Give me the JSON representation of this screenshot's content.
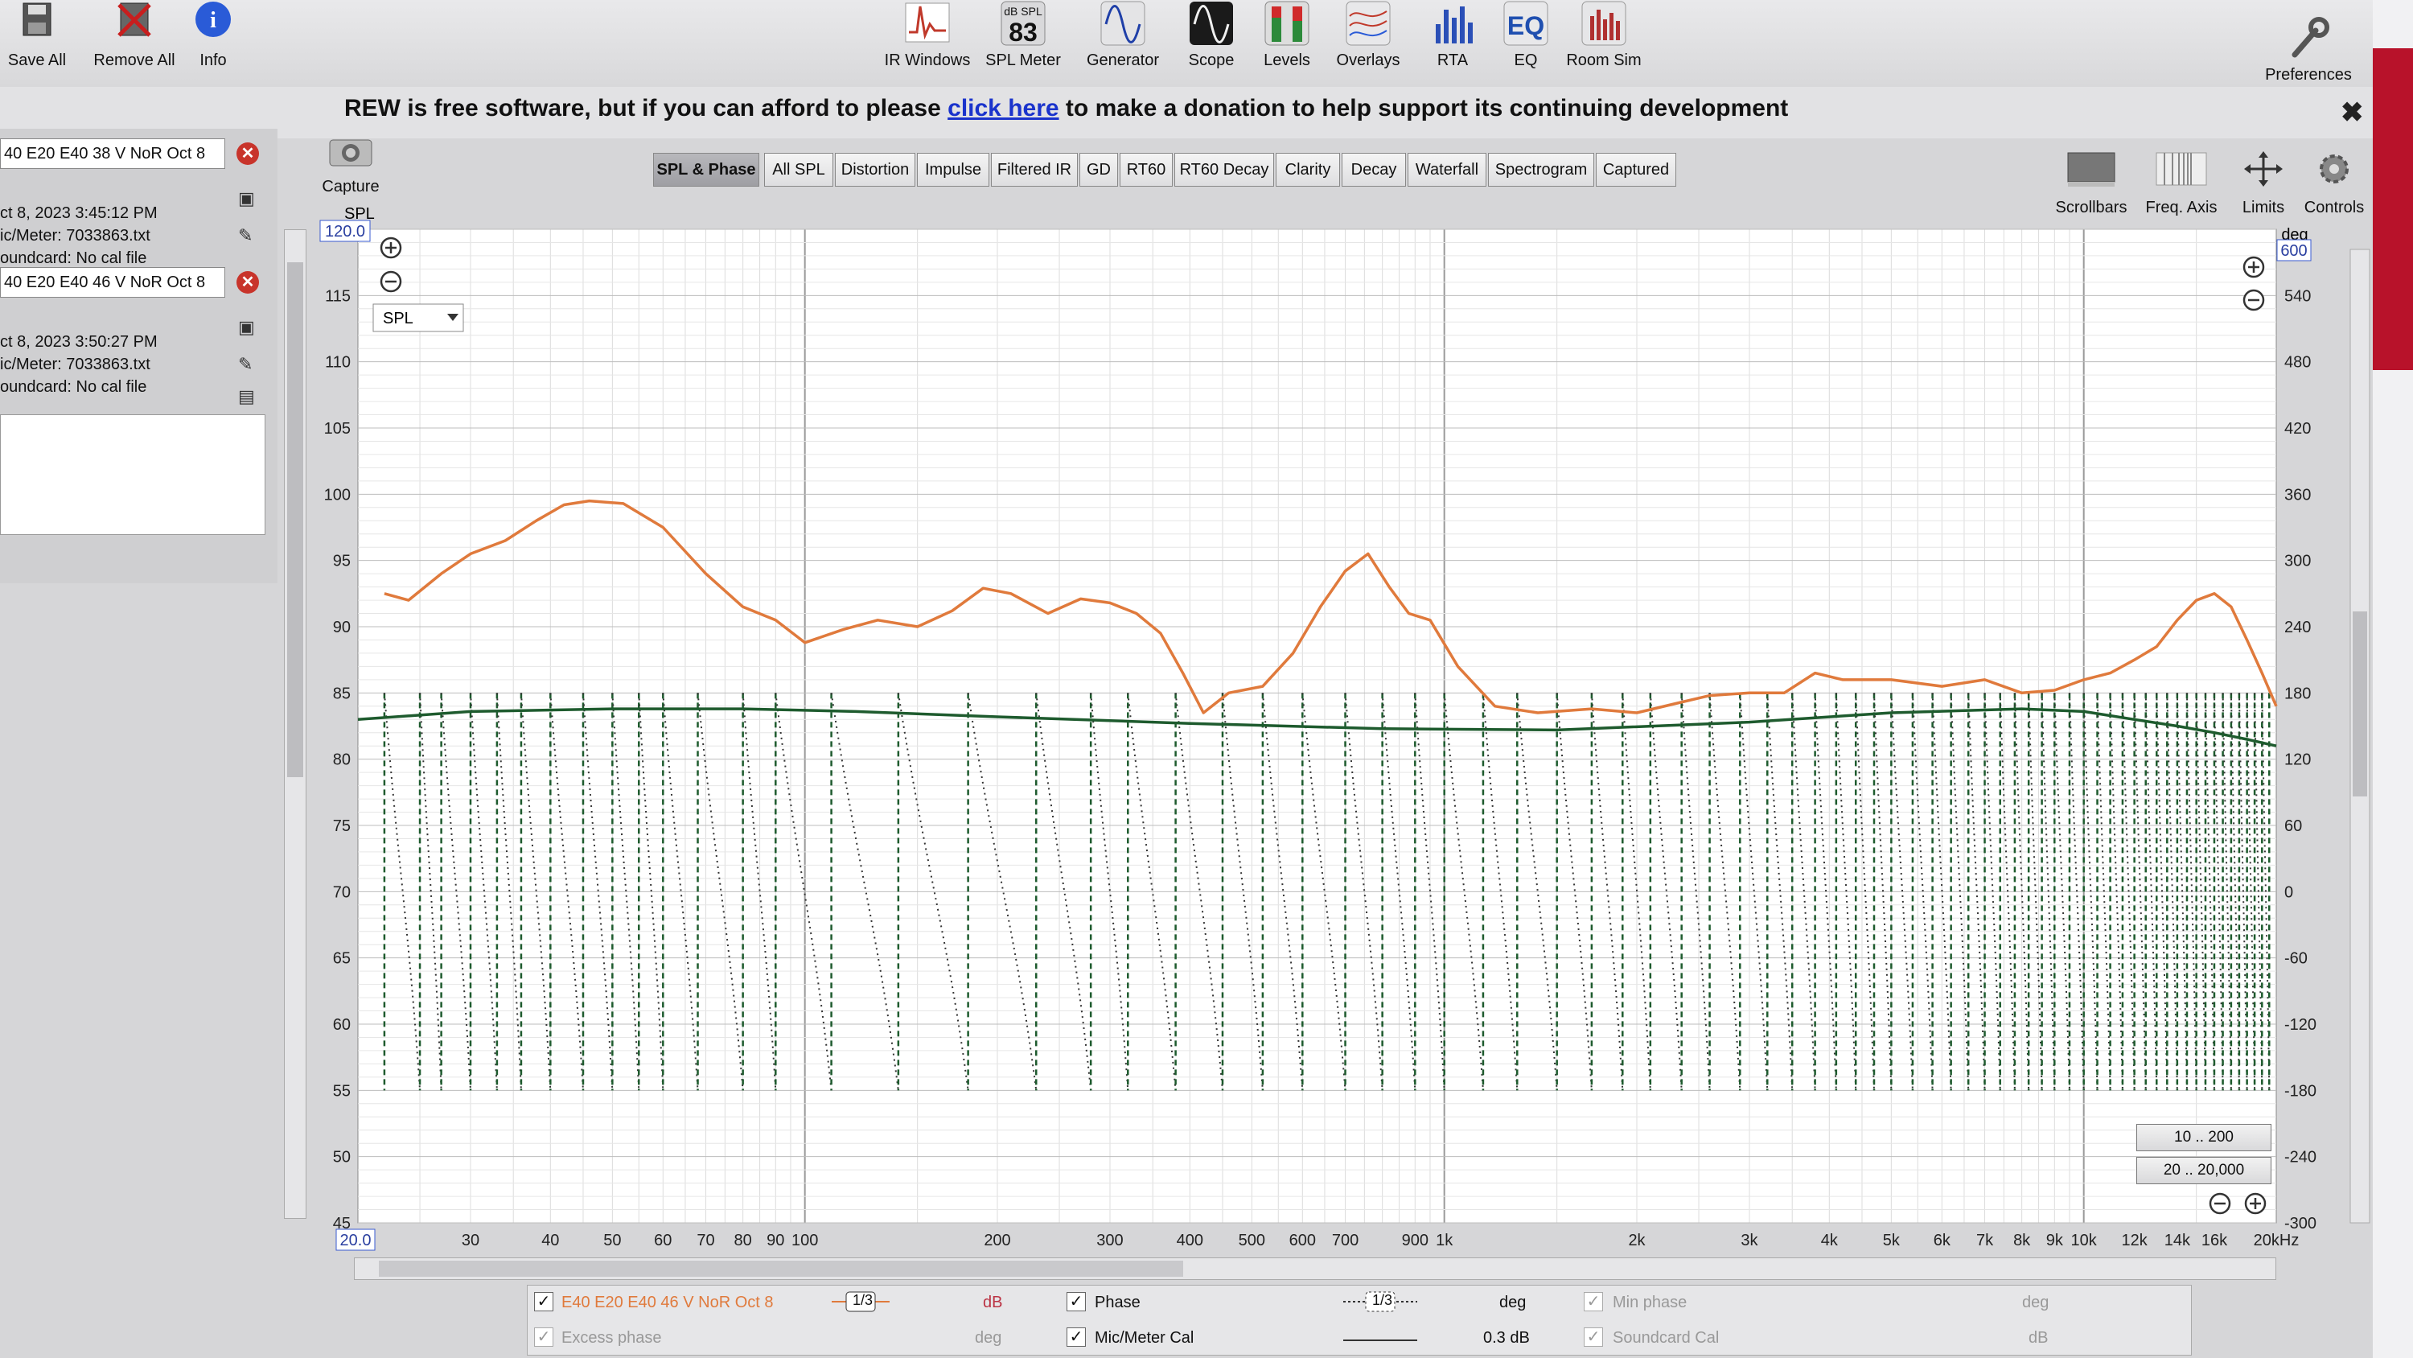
{
  "toolbar": {
    "left_buttons": [
      {
        "id": "save-all",
        "label": "Save All"
      },
      {
        "id": "remove-all",
        "label": "Remove All"
      },
      {
        "id": "info",
        "label": "Info"
      }
    ],
    "buttons": [
      {
        "id": "ir-windows",
        "label": "IR Windows"
      },
      {
        "id": "spl-meter",
        "label": "SPL Meter",
        "top": "dB SPL",
        "value": "83"
      },
      {
        "id": "generator",
        "label": "Generator"
      },
      {
        "id": "scope",
        "label": "Scope"
      },
      {
        "id": "levels",
        "label": "Levels"
      },
      {
        "id": "overlays",
        "label": "Overlays"
      },
      {
        "id": "rta",
        "label": "RTA"
      },
      {
        "id": "eq",
        "label": "EQ",
        "icon_text": "EQ"
      },
      {
        "id": "room-sim",
        "label": "Room Sim"
      }
    ],
    "preferences_label": "Preferences"
  },
  "banner": {
    "before": "REW is free software, but if you can afford to please ",
    "link": "click here",
    "after": " to make a donation to help support its continuing development",
    "close": "✖"
  },
  "measurements": [
    {
      "name": "40 E20 E40 38 V NoR Oct 8",
      "date": "ct 8, 2023 3:45:12 PM",
      "mic": "ic/Meter: 7033863.txt",
      "soundcard": "oundcard: No cal file"
    },
    {
      "name": "40 E20 E40 46 V NoR Oct 8",
      "date": "ct 8, 2023 3:50:27 PM",
      "mic": "ic/Meter: 7033863.txt",
      "soundcard": "oundcard: No cal file"
    }
  ],
  "capture_label": "Capture",
  "tabs": [
    "SPL & Phase",
    "All SPL",
    "Distortion",
    "Impulse",
    "Filtered IR",
    "GD",
    "RT60",
    "RT60 Decay",
    "Clarity",
    "Decay",
    "Waterfall",
    "Spectrogram",
    "Captured"
  ],
  "active_tab": "SPL & Phase",
  "right_controls": [
    "Scrollbars",
    "Freq. Axis",
    "Limits",
    "Controls"
  ],
  "plot": {
    "spl_axis_label": "SPL",
    "spl_top_value": "120.0",
    "deg_axis_label": "deg",
    "deg_top_value": "600",
    "x_start_value": "20.0",
    "spl_select": "SPL",
    "range_buttons": [
      "10 .. 200",
      "20 .. 20,000"
    ]
  },
  "chart_data": {
    "type": "line",
    "x_scale": "log",
    "xlim": [
      20,
      20000
    ],
    "ylim_left": [
      45,
      120
    ],
    "ylim_right": [
      -300,
      600
    ],
    "ylabel_left": "SPL",
    "ylabel_right": "deg",
    "x_ticks": [
      {
        "v": 30,
        "t": "30"
      },
      {
        "v": 40,
        "t": "40"
      },
      {
        "v": 50,
        "t": "50"
      },
      {
        "v": 60,
        "t": "60"
      },
      {
        "v": 70,
        "t": "70"
      },
      {
        "v": 80,
        "t": "80"
      },
      {
        "v": 90,
        "t": "90"
      },
      {
        "v": 100,
        "t": "100"
      },
      {
        "v": 200,
        "t": "200"
      },
      {
        "v": 300,
        "t": "300"
      },
      {
        "v": 400,
        "t": "400"
      },
      {
        "v": 500,
        "t": "500"
      },
      {
        "v": 600,
        "t": "600"
      },
      {
        "v": 700,
        "t": "700"
      },
      {
        "v": 900,
        "t": "900"
      },
      {
        "v": 1000,
        "t": "1k"
      },
      {
        "v": 2000,
        "t": "2k"
      },
      {
        "v": 3000,
        "t": "3k"
      },
      {
        "v": 4000,
        "t": "4k"
      },
      {
        "v": 5000,
        "t": "5k"
      },
      {
        "v": 6000,
        "t": "6k"
      },
      {
        "v": 7000,
        "t": "7k"
      },
      {
        "v": 8000,
        "t": "8k"
      },
      {
        "v": 9000,
        "t": "9k"
      },
      {
        "v": 10000,
        "t": "10k"
      },
      {
        "v": 12000,
        "t": "12k"
      },
      {
        "v": 14000,
        "t": "14k"
      },
      {
        "v": 16000,
        "t": "16k"
      },
      {
        "v": 20000,
        "t": "20kHz"
      }
    ],
    "y_ticks_left": [
      115,
      110,
      105,
      100,
      95,
      90,
      85,
      80,
      75,
      70,
      65,
      60,
      55,
      50,
      45
    ],
    "y_ticks_right": [
      540,
      480,
      420,
      360,
      300,
      240,
      180,
      120,
      60,
      0,
      -60,
      -120,
      -180,
      -240,
      -300
    ],
    "series": [
      {
        "name": "E40 E20 E40 46 V NoR Oct 8",
        "color": "#e07a3c",
        "x": [
          22,
          24,
          27,
          30,
          34,
          38,
          42,
          46,
          52,
          60,
          70,
          80,
          90,
          100,
          115,
          130,
          150,
          170,
          190,
          210,
          240,
          270,
          300,
          330,
          360,
          390,
          420,
          460,
          520,
          580,
          640,
          700,
          760,
          820,
          880,
          950,
          1050,
          1200,
          1400,
          1700,
          2000,
          2300,
          2600,
          3000,
          3400,
          3800,
          4200,
          5000,
          6000,
          7000,
          8000,
          9000,
          10000,
          11000,
          12000,
          13000,
          14000,
          15000,
          16000,
          17000,
          18000,
          19000,
          20000
        ],
        "y": [
          92.5,
          92,
          94,
          95.5,
          96.5,
          98,
          99.2,
          99.5,
          99.3,
          97.5,
          94,
          91.5,
          90.5,
          88.8,
          89.8,
          90.5,
          90,
          91.2,
          92.9,
          92.5,
          91,
          92.1,
          91.8,
          91,
          89.5,
          86.5,
          83.5,
          85,
          85.5,
          88,
          91.5,
          94.2,
          95.5,
          93,
          91,
          90.5,
          87,
          84,
          83.5,
          83.8,
          83.5,
          84.2,
          84.8,
          85,
          85,
          86.5,
          86,
          86,
          85.5,
          86,
          85,
          85.2,
          86,
          86.5,
          87.5,
          88.5,
          90.5,
          92,
          92.5,
          91.5,
          89,
          86.5,
          84
        ]
      },
      {
        "name": "Phase",
        "color": "#1e5b2e",
        "x": [
          20,
          30,
          50,
          80,
          120,
          200,
          400,
          800,
          1500,
          3000,
          5000,
          8000,
          10000,
          12000,
          14000,
          16000,
          18000,
          20000
        ],
        "y": [
          83,
          83.6,
          83.8,
          83.8,
          83.6,
          83.2,
          82.7,
          82.3,
          82.2,
          82.8,
          83.5,
          83.8,
          83.6,
          83,
          82.5,
          82,
          81.5,
          81
        ]
      }
    ],
    "phase_wraps": {
      "color": "#1e5b2e",
      "x": [
        22,
        25,
        27,
        30,
        33,
        36,
        40,
        45,
        50,
        55,
        60,
        68,
        80,
        90,
        110,
        140,
        180,
        230,
        280,
        320,
        380,
        450,
        520,
        600,
        700,
        800,
        900,
        1000,
        1150,
        1300,
        1500,
        1700,
        1900,
        2100,
        2350,
        2600,
        2900,
        3200,
        3500,
        3800,
        4100,
        4400,
        4700,
        5000,
        5400,
        5800,
        6200,
        6600,
        7000,
        7400,
        7800,
        8200,
        8600,
        9000,
        9500,
        10000,
        10500,
        11000,
        11500,
        12000,
        12500,
        13000,
        13500,
        14000,
        14500,
        15000,
        15500,
        16000,
        16500,
        17000,
        17500,
        18000,
        18500,
        19000,
        19500
      ],
      "top": 180,
      "bottom": -180
    }
  },
  "legend": {
    "row1": [
      {
        "checked": true,
        "label": "E40 E20 E40 46 V NoR Oct 8",
        "smoothing": "1/3",
        "unit": "dB"
      },
      {
        "checked": true,
        "label": "Phase",
        "smoothing": "1/3",
        "unit": "deg"
      },
      {
        "checked": true,
        "label": "Min phase",
        "unit": "deg",
        "dim": true
      }
    ],
    "row2": [
      {
        "checked": true,
        "label": "Excess phase",
        "unit": "deg",
        "dim": true
      },
      {
        "checked": true,
        "label": "Mic/Meter Cal",
        "value": "0.3 dB"
      },
      {
        "checked": true,
        "label": "Soundcard Cal",
        "unit": "dB",
        "dim": true
      }
    ]
  }
}
